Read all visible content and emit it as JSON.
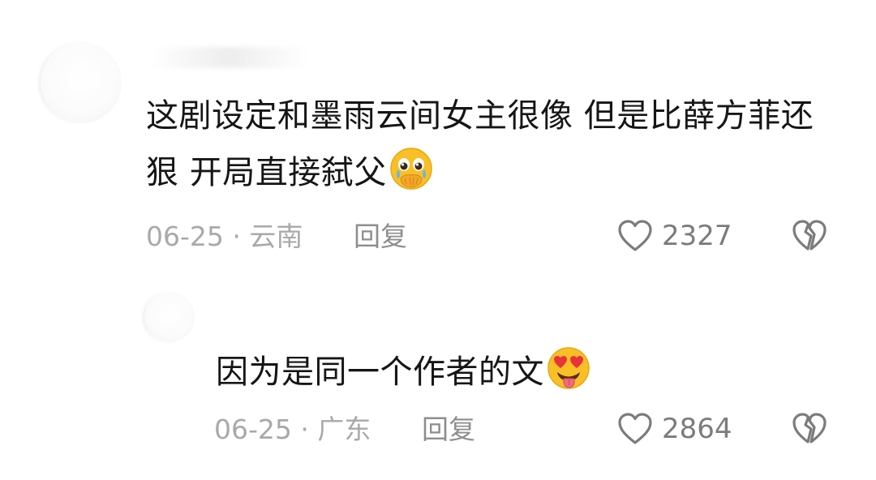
{
  "comments": [
    {
      "text": "这剧设定和墨雨云间女主很像 但是比薛方菲还狠 开局直接弑父",
      "emoji": "crying-face-hands-over-mouth-emoji",
      "date_location": "06-25 · 云南",
      "reply_label": "回复",
      "like_count": "2327"
    },
    {
      "text": "因为是同一个作者的文",
      "emoji": "heart-eyes-tongue-out-emoji",
      "date_location": "06-25 · 广东",
      "reply_label": "回复",
      "like_count": "2864"
    }
  ],
  "icons": {
    "like": "heart-outline-icon",
    "dislike": "broken-heart-icon"
  },
  "colors": {
    "text": "#161616",
    "meta": "#a9a9a9",
    "icon": "#7c7c7c",
    "emoji_yellow": "#f8c026",
    "emoji_red": "#e8333a"
  }
}
